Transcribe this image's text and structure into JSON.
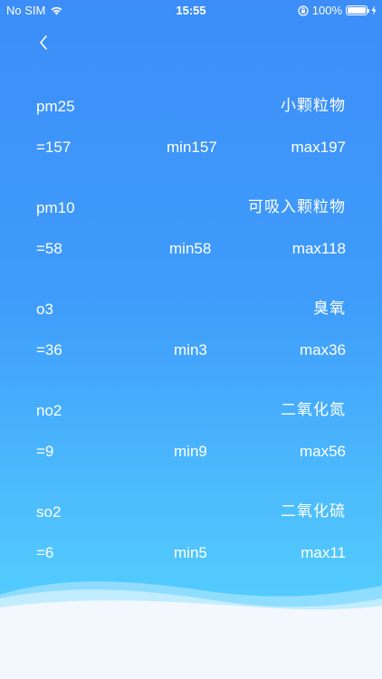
{
  "status_bar": {
    "carrier": "No SIM",
    "time": "15:55",
    "battery": "100%"
  },
  "nav": {
    "back_icon": "chevron-left-icon"
  },
  "pollutants": [
    {
      "code": "pm25",
      "name": "小颗粒物",
      "current": "=157",
      "min": "min157",
      "max": "max197"
    },
    {
      "code": "pm10",
      "name": "可吸入颗粒物",
      "current": "=58",
      "min": "min58",
      "max": "max118"
    },
    {
      "code": "o3",
      "name": "臭氧",
      "current": "=36",
      "min": "min3",
      "max": "max36"
    },
    {
      "code": "no2",
      "name": "二氧化氮",
      "current": "=9",
      "min": "min9",
      "max": "max56"
    },
    {
      "code": "so2",
      "name": "二氧化硫",
      "current": "=6",
      "min": "min5",
      "max": "max11"
    }
  ],
  "colors": {
    "gradient_top": "#3c8df8",
    "gradient_bottom": "#5fd7fe",
    "wave": "#f2f8fd"
  }
}
